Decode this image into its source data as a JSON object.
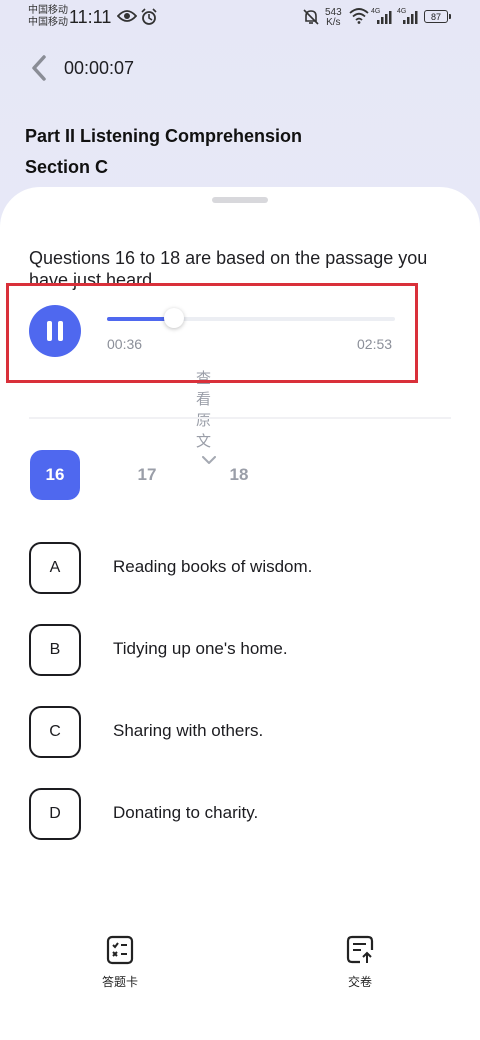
{
  "status_bar": {
    "carrier1": "中国移动",
    "carrier2": "中国移动",
    "time": "11:11",
    "net_speed_value": "543",
    "net_speed_unit": "K/s",
    "signal_label_1": "4G",
    "signal_label_2": "4G",
    "battery": "87"
  },
  "header": {
    "elapsed_time": "00:00:07",
    "part_title": "Part II Listening Comprehension",
    "section_title": "Section C"
  },
  "question": {
    "prompt": "Questions 16 to 18 are based on the passage you have just heard."
  },
  "player": {
    "state": "playing",
    "current_time": "00:36",
    "total_time": "02:53",
    "progress": 0.234,
    "transcript_label": "查看原文",
    "accent_color": "#4f68ef"
  },
  "question_tabs": [
    {
      "label": "16",
      "active": true
    },
    {
      "label": "17",
      "active": false
    },
    {
      "label": "18",
      "active": false
    }
  ],
  "options": [
    {
      "letter": "A",
      "text": "Reading books of wisdom."
    },
    {
      "letter": "B",
      "text": "Tidying up one's home."
    },
    {
      "letter": "C",
      "text": "Sharing with others."
    },
    {
      "letter": "D",
      "text": "Donating to charity."
    }
  ],
  "bottom_bar": {
    "answer_sheet_label": "答题卡",
    "submit_label": "交卷"
  },
  "annotation_color": "#d9303a"
}
